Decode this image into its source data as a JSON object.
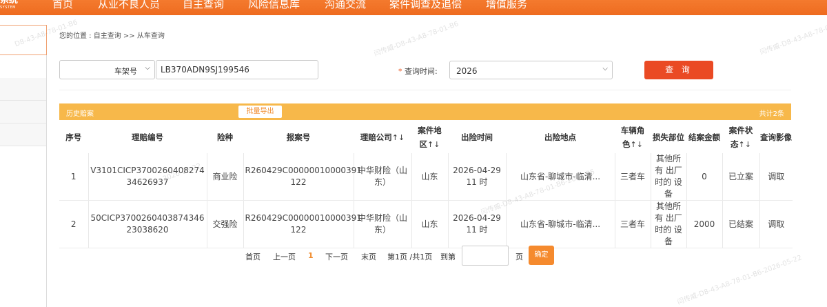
{
  "nav": {
    "logo_text": "系统",
    "logo_sub": "SYSTEM",
    "items": [
      "首页",
      "从业不良人员",
      "自主查询",
      "风险信息库",
      "沟通交流",
      "案件调查及追偿",
      "增值服务"
    ]
  },
  "breadcrumb": "您的位置 : 自主查询 >> 从车查询",
  "search": {
    "field_type": "车架号",
    "vin_value": "LB370ADN9SJ199546",
    "time_label_required": "*",
    "time_label": " 查询时间:",
    "time_value": "2026",
    "query_button": "查 询"
  },
  "results_bar": {
    "title": "历史赔案",
    "export_button": "批量导出",
    "count": "共计2条"
  },
  "table": {
    "headers": {
      "seq": "序号",
      "claim_no": "理赔编号",
      "insurance_type": "险种",
      "report_no": "报案号",
      "company": "理赔公司",
      "region_a": "案件地",
      "region_b": "区",
      "time": "出险时间",
      "place": "出险地点",
      "role_a": "车辆角",
      "role_b": "色",
      "loss_part": "损失部位",
      "amount": "结案金额",
      "status_a": "案件状",
      "status_b": "态",
      "image": "查询影像",
      "sort_icon": "↑↓"
    },
    "rows": [
      {
        "seq": "1",
        "claim_no": "V3101CICP3700260408274 34626937",
        "insurance_type": "商业险",
        "report_no": "R260429C00000010000391 122",
        "company": "中华财险（山 东）",
        "region": "山东",
        "time": "2026-04-29 11 时",
        "place": "山东省-聊城市-临清...",
        "role": "三者车",
        "loss_part": "其他所有 出厂时的 设备",
        "amount": "0",
        "status": "已立案",
        "image": "调取"
      },
      {
        "seq": "2",
        "claim_no": "50CICP3700260403874346 23038620",
        "insurance_type": "交强险",
        "report_no": "R260429C00000010000391 122",
        "company": "中华财险（山 东）",
        "region": "山东",
        "time": "2026-04-29 11 时",
        "place": "山东省-聊城市-临清...",
        "role": "三者车",
        "loss_part": "其他所有 出厂时的 设备",
        "amount": "2000",
        "status": "已结案",
        "image": "调取"
      }
    ]
  },
  "pagination": {
    "first": "首页",
    "prev": "上一页",
    "current": "1",
    "next": "下一页",
    "last": "末页",
    "info": "第1页 /共1页",
    "goto": "到第",
    "page_suffix": "页",
    "ok": "确定"
  },
  "watermarks": {
    "w1": "D8-43-A8-78-01-B6",
    "w2": "2026-05-22",
    "w3": "闫传威-D8-43-A8-78-01-B6",
    "w4": "闫传威-D8-43-A8-78-01-B6-2026-05",
    "w5": "闫传威-D8-43-A8-78-01-B6-2026-05-22",
    "w6": "闫传威-D8-43-A8-78-01-B6"
  },
  "colors": {
    "nav_orange": "#ef6d20",
    "results_bar": "#f7b84a",
    "query_button": "#ea4a24",
    "ok_button": "#f58a2e"
  }
}
